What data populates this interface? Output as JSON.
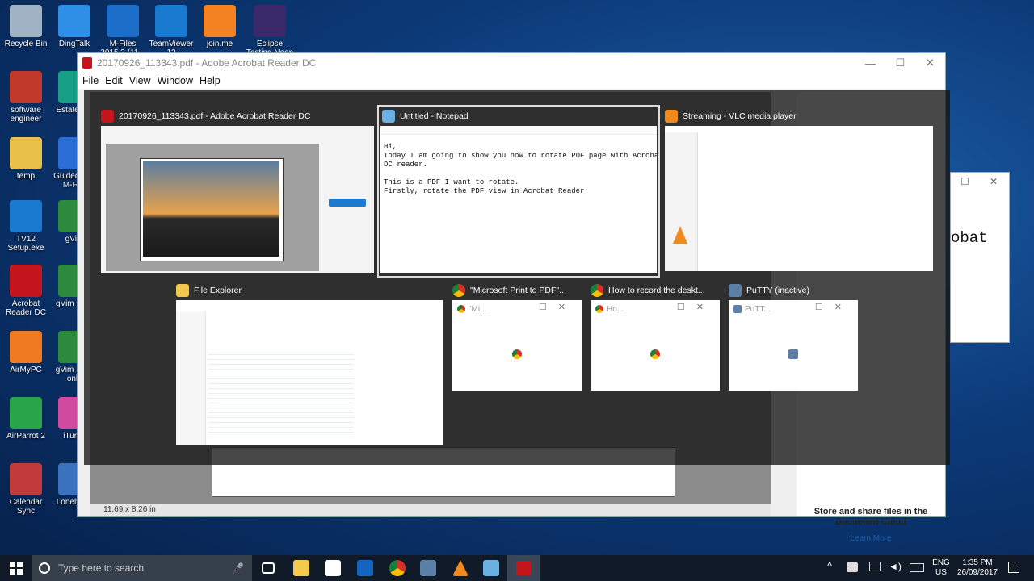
{
  "desktop": {
    "icons": [
      {
        "label": "Recycle Bin",
        "color": "#9fb3c4"
      },
      {
        "label": "DingTalk",
        "color": "#2f8fe6"
      },
      {
        "label": "M-Files 2015.3 (11...",
        "color": "#1d6ec9"
      },
      {
        "label": "TeamViewer 12",
        "color": "#1a7ad0"
      },
      {
        "label": "join.me",
        "color": "#f58220"
      },
      {
        "label": "Eclipse Testing Neon",
        "color": "#3b2a6b"
      },
      {
        "label": "software engineer",
        "color": "#c0392b"
      },
      {
        "label": "EstateM...",
        "color": "#18a086"
      },
      {
        "label": "temp",
        "color": "#e8c04a"
      },
      {
        "label": "Guided... of M-Fi...",
        "color": "#2b6fd6"
      },
      {
        "label": "TV12 Setup.exe",
        "color": "#1a7ad0"
      },
      {
        "label": "gVim",
        "color": "#2c8a3c"
      },
      {
        "label": "Acrobat Reader DC",
        "color": "#c4161c"
      },
      {
        "label": "gVim Ea...",
        "color": "#2c8a3c"
      },
      {
        "label": "AirMyPC",
        "color": "#f07a20"
      },
      {
        "label": "gVim Re... only",
        "color": "#2c8a3c"
      },
      {
        "label": "AirParrot 2",
        "color": "#2aa44a"
      },
      {
        "label": "iTun...",
        "color": "#d04aa0"
      },
      {
        "label": "Calendar Sync",
        "color": "#c23a3a"
      },
      {
        "label": "LonelyS...",
        "color": "#3b72c0"
      }
    ]
  },
  "acrobat": {
    "title": "20170926_113343.pdf - Adobe Acrobat Reader DC",
    "window_controls": [
      "—",
      "☐",
      "✕"
    ],
    "menu": [
      "File",
      "Edit",
      "View",
      "Window",
      "Help"
    ],
    "status_size": "11.69 x 8.26 in",
    "panel_title": "Store and share files in the Document Cloud",
    "panel_link": "Learn More"
  },
  "notepad_back": {
    "text": "obat"
  },
  "taskview": {
    "windows": [
      {
        "title": "20170926_113343.pdf - Adobe Acrobat Reader DC",
        "icon_color": "#c4161c"
      },
      {
        "title": "Untitled - Notepad",
        "icon_color": "#6ab0e0",
        "content": "Hi,\nToday I am going to show you how to rotate PDF page with Acrobat\nDC reader.\n\nThis is a PDF I want to rotate.\nFirstly, rotate the PDF view in Acrobat Reader"
      },
      {
        "title": "Streaming - VLC media player",
        "icon_color": "#f08a1c"
      },
      {
        "title": "File Explorer",
        "icon_color": "#f2c94c"
      },
      {
        "title": "\"Microsoft Print to PDF\"...",
        "icon_color": "#d93025",
        "inner": "\"Mi..."
      },
      {
        "title": "How to record the deskt...",
        "icon_color": "#d93025",
        "inner": "Ho..."
      },
      {
        "title": "PuTTY (inactive)",
        "icon_color": "#5b7fa6",
        "inner": "PuTT..."
      }
    ]
  },
  "taskbar": {
    "search_placeholder": "Type here to search",
    "tray_lang": "ENG",
    "tray_region": "US",
    "time": "1:35 PM",
    "date": "26/09/2017"
  }
}
